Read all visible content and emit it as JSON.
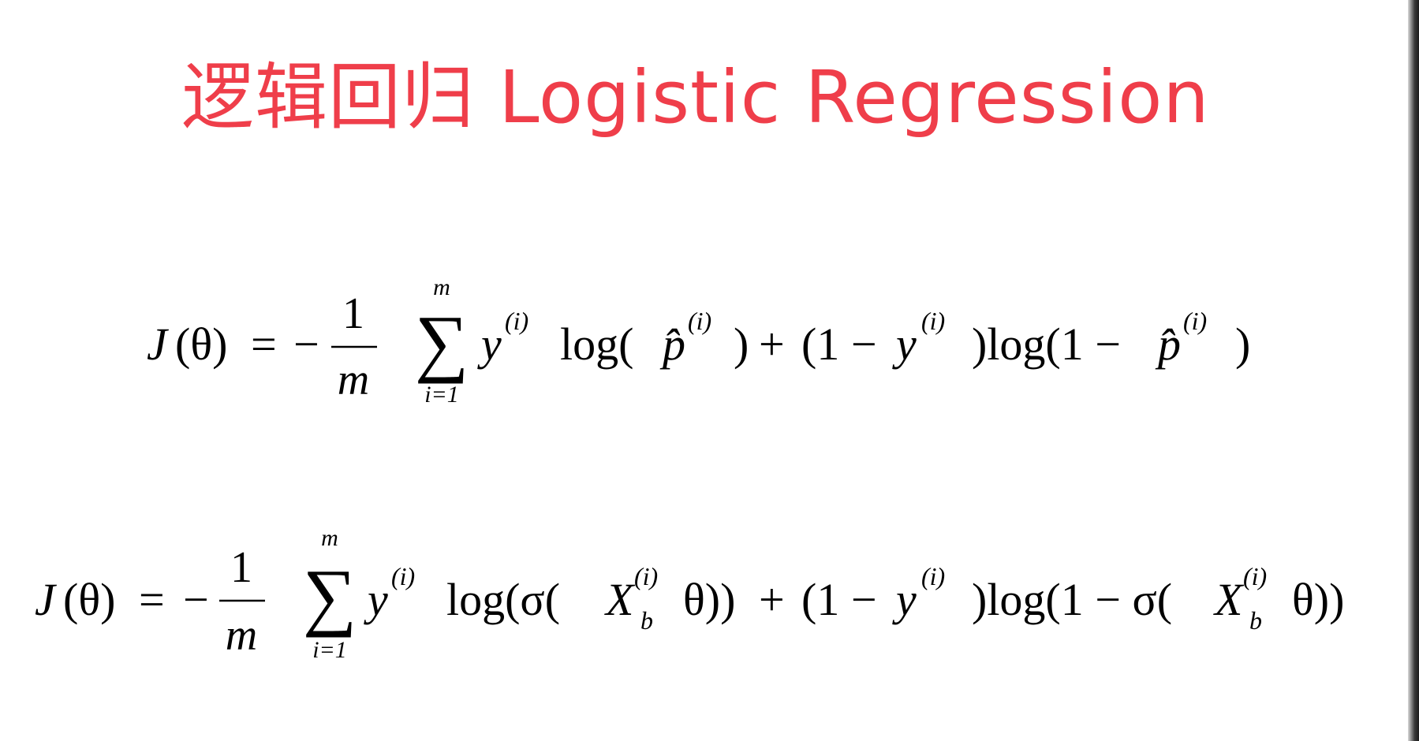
{
  "slide": {
    "title": "逻辑回归 Logistic Regression",
    "title_color": "#ef3e4a"
  },
  "formula1": {
    "lhs_J": "J",
    "lhs_theta": "(θ)",
    "eq": "=",
    "minus": "−",
    "frac_num": "1",
    "frac_den": "m",
    "sum_symbol": "∑",
    "sum_upper": "m",
    "sum_lower": "i=1",
    "y": "y",
    "sup_i": "(i)",
    "log": "log(",
    "p_hat": "p̂",
    "close": ")",
    "plus": "+",
    "one_minus": "(1 −",
    "log1m": ")log(1 −",
    "p_hat2": "p̂",
    "close2": ")"
  },
  "formula2": {
    "lhs_J": "J",
    "lhs_theta": "(θ)",
    "eq": "=",
    "minus": "−",
    "frac_num": "1",
    "frac_den": "m",
    "sum_symbol": "∑",
    "sum_upper": "m",
    "sum_lower": "i=1",
    "y": "y",
    "sup_i": "(i)",
    "log_sigma": "log(σ(",
    "X": "X",
    "sub_b": "b",
    "theta_close": "θ))",
    "plus": "+",
    "one_minus": "(1 −",
    "log1m_sigma": ")log(1 − σ(",
    "X2": "X",
    "theta_close2": "θ))"
  }
}
